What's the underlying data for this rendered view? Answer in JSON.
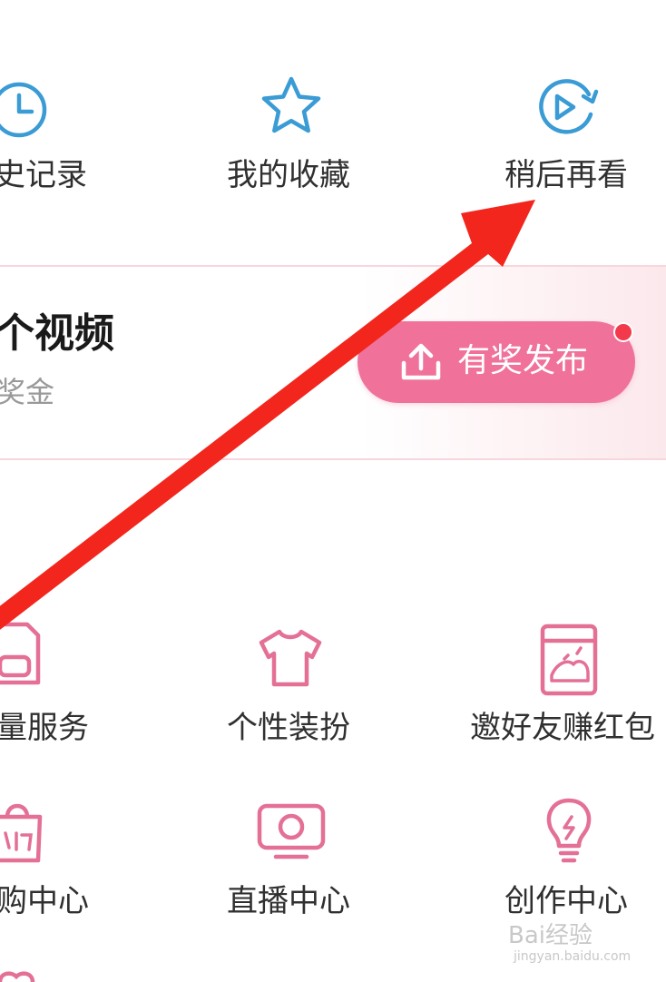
{
  "top_row": {
    "history_label": "史记录",
    "favorites_label": "我的收藏",
    "watch_later_label": "稍后再看"
  },
  "banner": {
    "title": "个视频",
    "subtitle": "奖金",
    "publish_button": "有奖发布"
  },
  "services_row1": {
    "traffic_label": "量服务",
    "dressup_label": "个性装扮",
    "invite_label": "邀好友赚红包"
  },
  "services_row2": {
    "shop_label": "购中心",
    "live_label": "直播中心",
    "creator_label": "创作中心"
  },
  "watermark": {
    "brand": "Bai经验",
    "url": "jingyan.baidu.com"
  },
  "colors": {
    "blue_icon": "#3a9bd5",
    "pink_icon": "#e47096",
    "button": "#f0729a",
    "arrow": "#f2261c"
  }
}
